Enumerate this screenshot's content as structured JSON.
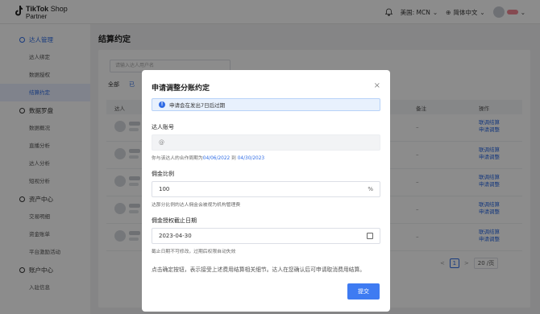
{
  "brand": {
    "line1": "TikTok",
    "line1b": " Shop",
    "line2": "Partner"
  },
  "topbar": {
    "region": "美国: MCN",
    "language": "简体中文"
  },
  "sidebar": {
    "groups": [
      {
        "label": "达人管理",
        "items": [
          "达人绑定",
          "数据授权",
          "结算约定"
        ]
      },
      {
        "label": "数据罗盘",
        "items": [
          "数据概况",
          "直播分析",
          "达人分析",
          "短视分析"
        ]
      },
      {
        "label": "资产中心",
        "items": [
          "交易明细",
          "资金账单",
          "平台激励活动"
        ]
      },
      {
        "label": "账户中心",
        "items": [
          "入驻信息"
        ]
      }
    ]
  },
  "main": {
    "title": "结算约定",
    "search_placeholder": "请输入达人用户名",
    "tabs": [
      "全部",
      "已"
    ],
    "columns": {
      "creator": "达人",
      "remark": "备注",
      "action": "操作"
    },
    "rows": [
      {
        "dash": "–",
        "action1": "联调结算",
        "action2": "申请调整"
      },
      {
        "dash": "–",
        "action1": "联调结算",
        "action2": "申请调整"
      },
      {
        "dash": "–",
        "action1": "联调结算",
        "action2": "申请调整"
      },
      {
        "dash": "–",
        "action1": "联调结算",
        "action2": "申请调整"
      },
      {
        "dash": "–",
        "action1": "联调结算",
        "action2": "申请调整"
      }
    ],
    "pager": {
      "prev": "<",
      "current": "1",
      "next": ">",
      "page_size": "20 /页"
    }
  },
  "modal": {
    "title": "申请调整分账约定",
    "close": "×",
    "alert": "申请会在发出7日后过期",
    "account_label": "达人账号",
    "account_value": "@",
    "account_hint_prefix": "你与该达人的合作周期为",
    "account_hint_start": "04/06/2022",
    "account_hint_to": " 到 ",
    "account_hint_end": "04/30/2023",
    "ratio_label": "佣金比例",
    "ratio_value": "100",
    "ratio_suffix": "%",
    "ratio_hint": "达那分比例的达人佣金会被视为机构管理费",
    "date_label": "佣金授权截止日期",
    "date_value": "2023-04-30",
    "date_hint": "截止日期不可修改，过期后权限自动失效",
    "note": "点击确定按钮，表示接受上述费用结算相关细节。达人在您确认后可申请取消费用结算。",
    "submit": "提交"
  },
  "colors": {
    "accent": "#2f6ce5",
    "submit": "#3e7bf2"
  }
}
